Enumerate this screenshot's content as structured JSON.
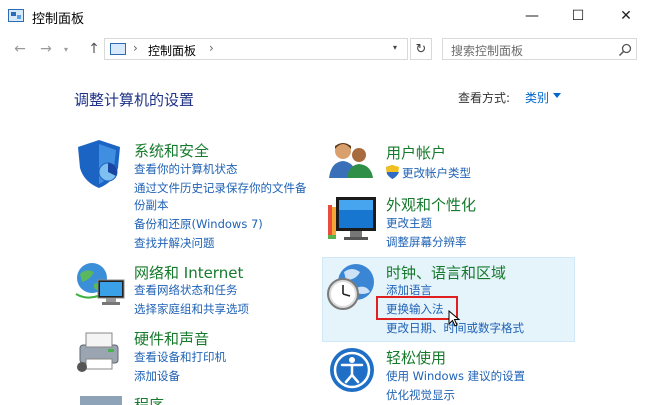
{
  "window": {
    "title": "控制面板"
  },
  "window_controls": {
    "minimize": "—",
    "maximize": "☐",
    "close": "✕"
  },
  "nav": {
    "back": "←",
    "forward": "→",
    "up": "↑"
  },
  "address": {
    "sep": "›",
    "crumb": "控制面板"
  },
  "search": {
    "placeholder": "搜索控制面板"
  },
  "heading": "调整计算机的设置",
  "view_by": {
    "label": "查看方式:",
    "value": "类别"
  },
  "left_categories": [
    {
      "title": "系统和安全",
      "icon": "shield-icon",
      "links": [
        "查看你的计算机状态",
        "通过文件历史记录保存你的文件备",
        "份副本",
        "备份和还原(Windows 7)",
        "查找并解决问题"
      ]
    },
    {
      "title": "网络和 Internet",
      "icon": "network-icon",
      "links": [
        "查看网络状态和任务",
        "选择家庭组和共享选项"
      ]
    },
    {
      "title": "硬件和声音",
      "icon": "printer-icon",
      "links": [
        "查看设备和打印机",
        "添加设备"
      ]
    },
    {
      "title": "程序",
      "icon": "programs-icon",
      "links": []
    }
  ],
  "right_categories": [
    {
      "title": "用户帐户",
      "icon": "users-icon",
      "links": [
        "更改帐户类型"
      ]
    },
    {
      "title": "外观和个性化",
      "icon": "monitor-icon",
      "links": [
        "更改主题",
        "调整屏幕分辨率"
      ]
    },
    {
      "title": "时钟、语言和区域",
      "icon": "clock-globe-icon",
      "links": [
        "添加语言",
        "更换输入法",
        "更改日期、时间或数字格式"
      ]
    },
    {
      "title": "轻松使用",
      "icon": "ease-of-access-icon",
      "links": [
        "使用 Windows 建议的设置",
        "优化视觉显示"
      ]
    }
  ],
  "colors": {
    "accent": "#1f62b5",
    "category_title": "#157a2b",
    "highlight": "#e5f3fb",
    "marker": "#e0201f"
  }
}
